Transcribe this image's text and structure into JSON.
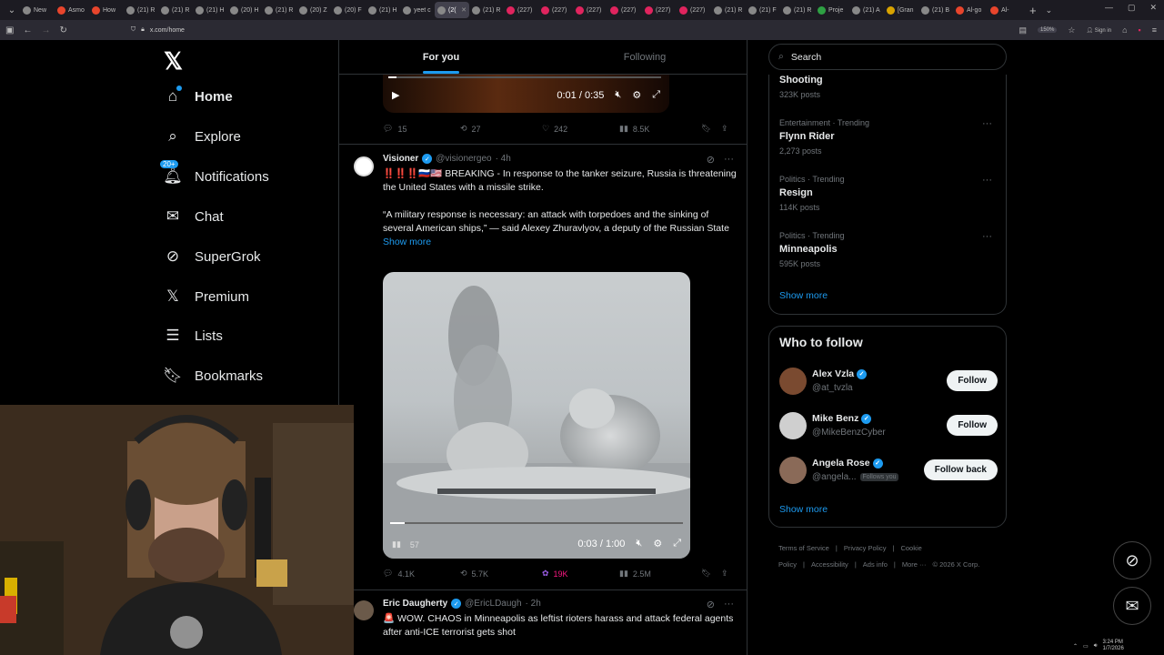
{
  "browser": {
    "url": "x.com/home",
    "zoom": "150%",
    "sign_in": "Sign in",
    "tabs": [
      {
        "label": "New",
        "color": "#888"
      },
      {
        "label": "Asmo",
        "color": "#e8452c"
      },
      {
        "label": "How",
        "color": "#e8452c"
      },
      {
        "label": "(21) R",
        "color": "#888"
      },
      {
        "label": "(21) R",
        "color": "#888"
      },
      {
        "label": "(21) H",
        "color": "#888"
      },
      {
        "label": "(20) H",
        "color": "#888"
      },
      {
        "label": "(21) R",
        "color": "#888"
      },
      {
        "label": "(20) Z",
        "color": "#888"
      },
      {
        "label": "(20) F",
        "color": "#888"
      },
      {
        "label": "(21) H",
        "color": "#888"
      },
      {
        "label": "yeet c",
        "color": "#888"
      },
      {
        "label": "(2(",
        "color": "#888",
        "active": true
      },
      {
        "label": "(21) R",
        "color": "#888"
      },
      {
        "label": "(227)",
        "color": "#e0245e"
      },
      {
        "label": "(227)",
        "color": "#e0245e"
      },
      {
        "label": "(227)",
        "color": "#e0245e"
      },
      {
        "label": "(227)",
        "color": "#e0245e"
      },
      {
        "label": "(227)",
        "color": "#e0245e"
      },
      {
        "label": "(227)",
        "color": "#e0245e"
      },
      {
        "label": "(21) R",
        "color": "#888"
      },
      {
        "label": "(21) F",
        "color": "#888"
      },
      {
        "label": "(21) R",
        "color": "#888"
      },
      {
        "label": "Proje",
        "color": "#2ea043"
      },
      {
        "label": "(21) A",
        "color": "#888"
      },
      {
        "label": "[Gran",
        "color": "#d8a300"
      },
      {
        "label": "(21) B",
        "color": "#888"
      },
      {
        "label": "Al-go",
        "color": "#e8452c"
      },
      {
        "label": "Al-",
        "color": "#e8452c"
      }
    ]
  },
  "sidebar": {
    "home": "Home",
    "explore": "Explore",
    "notifications": "Notifications",
    "notifications_badge": "20+",
    "chat": "Chat",
    "supergrok": "SuperGrok",
    "premium": "Premium",
    "lists": "Lists",
    "bookmarks": "Bookmarks"
  },
  "feed": {
    "tab_for_you": "For you",
    "tab_following": "Following",
    "prev_video_time": "0:01 / 0:35",
    "prev_actions": {
      "replies": "15",
      "reposts": "27",
      "likes": "242",
      "views": "8.5K"
    },
    "tweet1": {
      "name": "Visioner",
      "handle": "@visionergeo",
      "time": "· 4h",
      "line1": "‼️‼️‼️🇷🇺🇺🇸 BREAKING - In response to the tanker seizure, Russia is threatening the United States with a missile strike.",
      "line2": "“A military response is necessary: an attack with torpedoes and the sinking of several American ships,” — said Alexey Zhuravlyov, a deputy of the Russian State",
      "show_more": "Show more",
      "video_time": "0:03 / 1:00",
      "video_left": "57",
      "actions": {
        "replies": "4.1K",
        "reposts": "5.7K",
        "likes": "19K",
        "views": "2.5M"
      }
    },
    "tweet2": {
      "name": "Eric Daugherty",
      "handle": "@EricLDaugh",
      "time": "· 2h",
      "text": "🚨 WOW. CHAOS in Minneapolis as leftist rioters harass and attack federal agents after anti-ICE terrorist gets shot"
    }
  },
  "right": {
    "search_placeholder": "Search",
    "trends": [
      {
        "category": "",
        "name": "Shooting",
        "count": "323K posts"
      },
      {
        "category": "Entertainment · Trending",
        "name": "Flynn Rider",
        "count": "2,273 posts"
      },
      {
        "category": "Politics · Trending",
        "name": "Resign",
        "count": "114K posts"
      },
      {
        "category": "Politics · Trending",
        "name": "Minneapolis",
        "count": "595K posts"
      }
    ],
    "show_more": "Show more",
    "who_title": "Who to follow",
    "who": [
      {
        "name": "Alex Vzla",
        "handle": "@at_tvzla",
        "button": "Follow",
        "follows_you": ""
      },
      {
        "name": "Mike Benz",
        "handle": "@MikeBenzCyber",
        "button": "Follow",
        "follows_you": ""
      },
      {
        "name": "Angela Rose",
        "handle": "@angela...",
        "button": "Follow back",
        "follows_you": "Follows you"
      }
    ],
    "footer": [
      "Terms of Service",
      "|",
      "Privacy Policy",
      "|",
      "Cookie Policy",
      "|",
      "Accessibility",
      "|",
      "Ads info",
      "|",
      "More ···",
      "© 2026 X Corp."
    ]
  },
  "taskbar": {
    "time": "3:24 PM",
    "date": "1/7/2026"
  },
  "colors": {
    "accent": "#1d9bf0",
    "background": "#000000",
    "border": "#2f3336",
    "muted": "#71767b"
  }
}
